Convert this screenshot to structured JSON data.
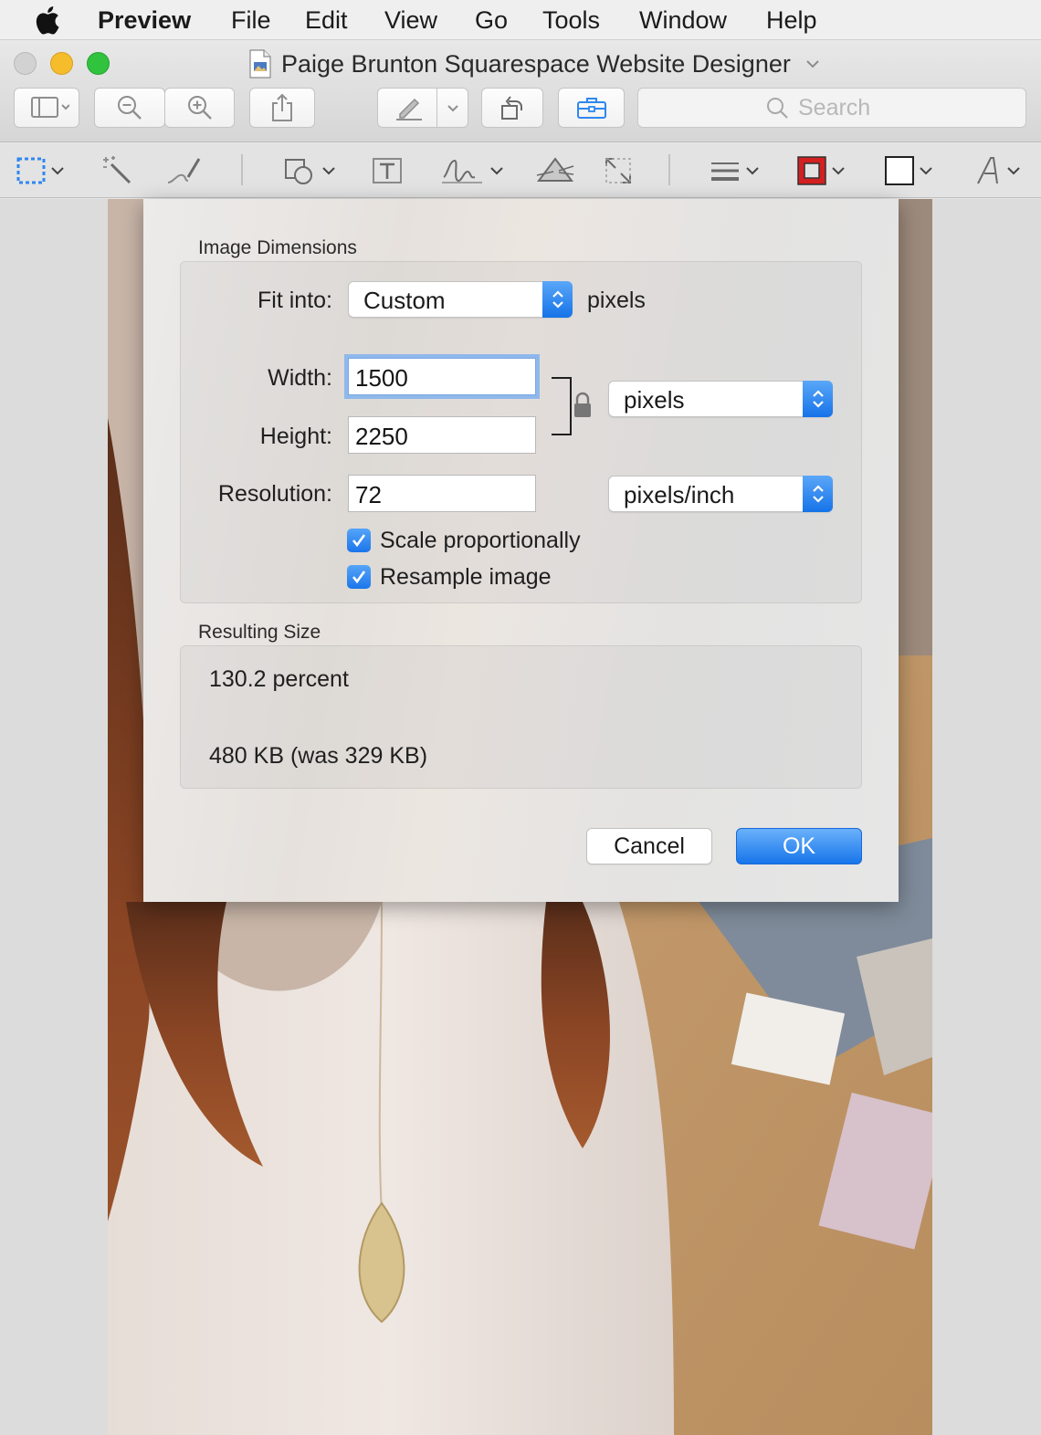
{
  "menubar": {
    "app_name": "Preview",
    "items": [
      "File",
      "Edit",
      "View",
      "Go",
      "Tools",
      "Window",
      "Help"
    ]
  },
  "window": {
    "title": "Paige Brunton Squarespace Website Designer",
    "search_placeholder": "Search"
  },
  "dialog": {
    "image_dimensions_label": "Image Dimensions",
    "fit_into_label": "Fit into:",
    "fit_into_value": "Custom",
    "fit_into_unit": "pixels",
    "width_label": "Width:",
    "width_value": "1500",
    "height_label": "Height:",
    "height_value": "2250",
    "size_unit_value": "pixels",
    "resolution_label": "Resolution:",
    "resolution_value": "72",
    "resolution_unit_value": "pixels/inch",
    "scale_proportionally_label": "Scale proportionally",
    "scale_proportionally_checked": true,
    "resample_label": "Resample image",
    "resample_checked": true,
    "resulting_size_label": "Resulting Size",
    "percent_text": "130.2 percent",
    "filesize_text": "480 KB (was 329 KB)",
    "cancel_label": "Cancel",
    "ok_label": "OK"
  },
  "colors": {
    "accent_blue": "#1775ea",
    "traffic_minimize": "#f5bd2c",
    "traffic_zoom": "#31c23e",
    "border_color_swatch": "#d32020",
    "fill_color_swatch": "#ffffff"
  }
}
